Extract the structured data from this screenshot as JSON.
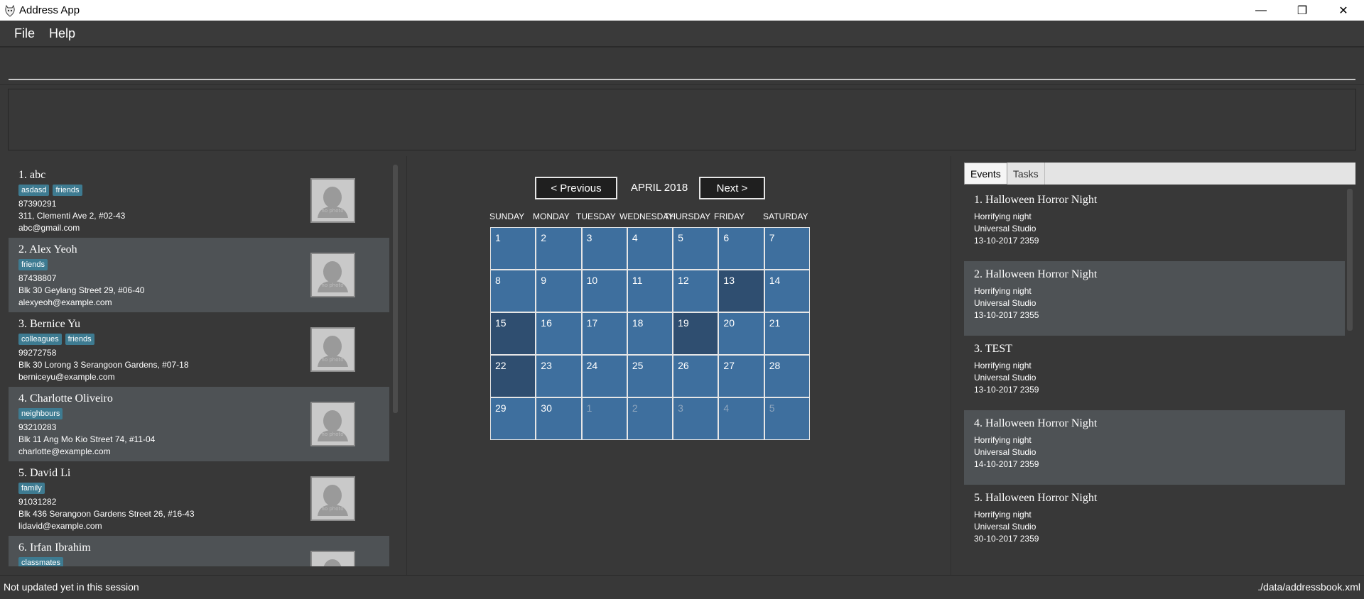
{
  "window": {
    "title": "Address App",
    "controls": [
      "—",
      "❐",
      "✕"
    ]
  },
  "menu": {
    "file": "File",
    "help": "Help"
  },
  "command_box": {
    "value": "",
    "placeholder": ""
  },
  "result_display": {
    "text": ""
  },
  "persons": [
    {
      "name": "1.  abc",
      "tags": [
        "asdasd",
        "friends"
      ],
      "phone": "87390291",
      "address": "311, Clementi Ave 2, #02-43",
      "email": "abc@gmail.com"
    },
    {
      "name": "2.  Alex Yeoh",
      "tags": [
        "friends"
      ],
      "phone": "87438807",
      "address": "Blk 30 Geylang Street 29, #06-40",
      "email": "alexyeoh@example.com"
    },
    {
      "name": "3.  Bernice Yu",
      "tags": [
        "colleagues",
        "friends"
      ],
      "phone": "99272758",
      "address": "Blk 30 Lorong 3 Serangoon Gardens, #07-18",
      "email": "berniceyu@example.com"
    },
    {
      "name": "4.  Charlotte Oliveiro",
      "tags": [
        "neighbours"
      ],
      "phone": "93210283",
      "address": "Blk 11 Ang Mo Kio Street 74, #11-04",
      "email": "charlotte@example.com"
    },
    {
      "name": "5.  David Li",
      "tags": [
        "family"
      ],
      "phone": "91031282",
      "address": "Blk 436 Serangoon Gardens Street 26, #16-43",
      "email": "lidavid@example.com"
    },
    {
      "name": "6.  Irfan Ibrahim",
      "tags": [
        "classmates"
      ],
      "phone": "",
      "address": "",
      "email": ""
    }
  ],
  "photo_caption": "no photo",
  "calendar": {
    "prev_label": "< Previous",
    "next_label": "Next >",
    "month": "APRIL 2018",
    "days": [
      "SUNDAY",
      "MONDAY",
      "TUESDAY",
      "WEDNESDAY",
      "THURSDAY",
      "FRIDAY",
      "SATURDAY"
    ],
    "cells": [
      {
        "d": "1"
      },
      {
        "d": "2"
      },
      {
        "d": "3"
      },
      {
        "d": "4"
      },
      {
        "d": "5"
      },
      {
        "d": "6"
      },
      {
        "d": "7"
      },
      {
        "d": "8"
      },
      {
        "d": "9"
      },
      {
        "d": "10"
      },
      {
        "d": "11"
      },
      {
        "d": "12"
      },
      {
        "d": "13",
        "hl": true
      },
      {
        "d": "14"
      },
      {
        "d": "15",
        "hl": true
      },
      {
        "d": "16"
      },
      {
        "d": "17"
      },
      {
        "d": "18"
      },
      {
        "d": "19",
        "hl": true
      },
      {
        "d": "20"
      },
      {
        "d": "21"
      },
      {
        "d": "22",
        "hl": true
      },
      {
        "d": "23"
      },
      {
        "d": "24"
      },
      {
        "d": "25"
      },
      {
        "d": "26"
      },
      {
        "d": "27"
      },
      {
        "d": "28"
      },
      {
        "d": "29"
      },
      {
        "d": "30"
      },
      {
        "d": "1",
        "other": true
      },
      {
        "d": "2",
        "other": true
      },
      {
        "d": "3",
        "other": true
      },
      {
        "d": "4",
        "other": true
      },
      {
        "d": "5",
        "other": true
      }
    ]
  },
  "tabs": {
    "events": "Events",
    "tasks": "Tasks"
  },
  "events": [
    {
      "title": "1. Halloween Horror Night",
      "desc": "Horrifying night",
      "venue": "Universal Studio",
      "datetime": "13-10-2017 2359"
    },
    {
      "title": "2. Halloween Horror Night",
      "desc": "Horrifying night",
      "venue": "Universal Studio",
      "datetime": "13-10-2017 2355"
    },
    {
      "title": "3. TEST",
      "desc": "Horrifying night",
      "venue": "Universal Studio",
      "datetime": "13-10-2017 2359"
    },
    {
      "title": "4. Halloween Horror Night",
      "desc": "Horrifying night",
      "venue": "Universal Studio",
      "datetime": "14-10-2017 2359"
    },
    {
      "title": "5. Halloween Horror Night",
      "desc": "Horrifying night",
      "venue": "Universal Studio",
      "datetime": "30-10-2017 2359"
    }
  ],
  "status": {
    "left": "Not updated yet in this session",
    "right": "./data/addressbook.xml"
  },
  "colors": {
    "background": "#383838",
    "card_alt": "#4e5255",
    "tag": "#3e7b91",
    "calendar_cell": "#3e6f9e",
    "calendar_highlight": "#2f4e70"
  }
}
